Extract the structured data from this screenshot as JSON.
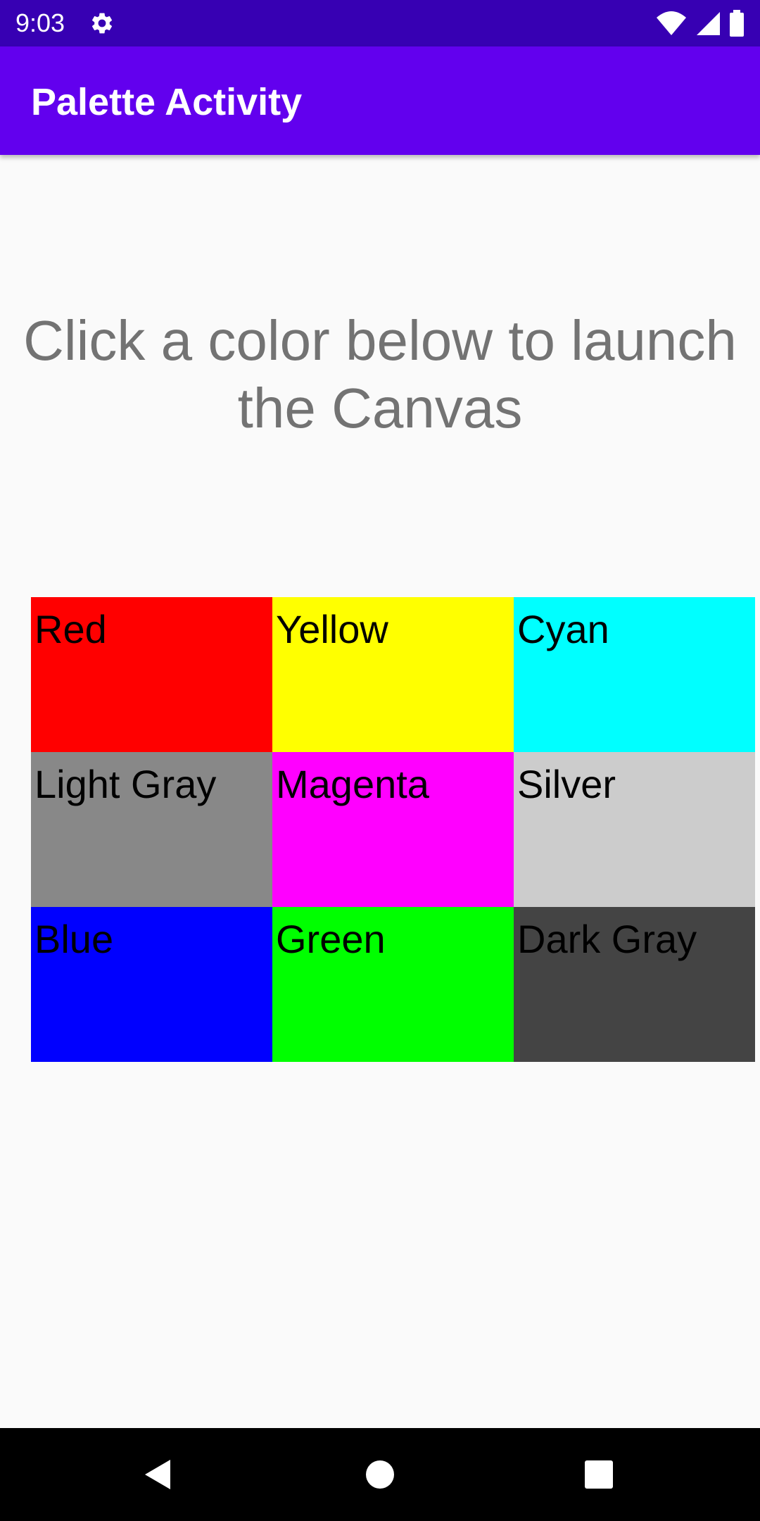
{
  "status_bar": {
    "time": "9:03",
    "icons": [
      "settings-icon",
      "wifi-icon",
      "cellular-signal-icon",
      "battery-icon"
    ],
    "background_color": "#3700B3"
  },
  "app_bar": {
    "title": "Palette Activity",
    "background_color": "#6200EE"
  },
  "instruction": {
    "text": "Click a color below to launch the Canvas",
    "color": "#737373"
  },
  "palette": [
    {
      "label": "Red",
      "color": "#FF0000"
    },
    {
      "label": "Yellow",
      "color": "#FFFF00"
    },
    {
      "label": "Cyan",
      "color": "#00FFFF"
    },
    {
      "label": "Light Gray",
      "color": "#888888"
    },
    {
      "label": "Magenta",
      "color": "#FF00FF"
    },
    {
      "label": "Silver",
      "color": "#CCCCCC"
    },
    {
      "label": "Blue",
      "color": "#0000FF"
    },
    {
      "label": "Green",
      "color": "#00FF00"
    },
    {
      "label": "Dark Gray",
      "color": "#444444"
    }
  ],
  "nav_bar": {
    "buttons": [
      "back-icon",
      "home-icon",
      "recents-icon"
    ],
    "background_color": "#000000"
  }
}
